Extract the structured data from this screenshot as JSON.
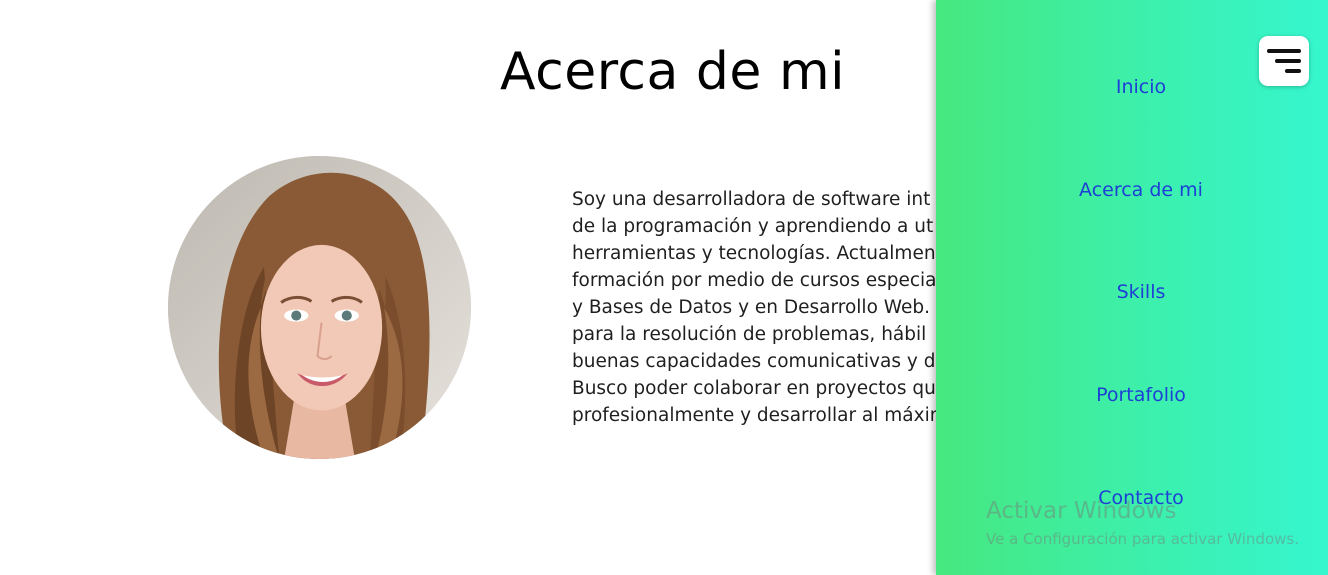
{
  "section": {
    "title": "Acerca de mi"
  },
  "profile": {
    "avatar_icon": "profile-photo"
  },
  "bio": {
    "lines": [
      "Soy una desarrolladora de software int",
      "de la programación y aprendiendo a ut",
      "herramientas y tecnologías. Actualmen",
      "formación por medio de cursos especia",
      "y Bases de Datos y en Desarrollo Web.",
      "para la resolución de problemas, hábil",
      "buenas capacidades comunicativas y de",
      "Busco poder colaborar en proyectos qu",
      "profesionalmente y desarrollar al máxin"
    ]
  },
  "menu": {
    "items": [
      {
        "label": "Inicio"
      },
      {
        "label": "Acerca de mi"
      },
      {
        "label": "Skills"
      },
      {
        "label": "Portafolio"
      },
      {
        "label": "Contacto"
      }
    ],
    "toggle_icon": "menu-lines-icon",
    "colors": {
      "gradient_start": "#46e87f",
      "gradient_end": "#36f6cf",
      "link": "#1e3fd6"
    }
  },
  "watermark": {
    "title": "Activar Windows",
    "subtitle": "Ve a Configuración para activar Windows."
  }
}
